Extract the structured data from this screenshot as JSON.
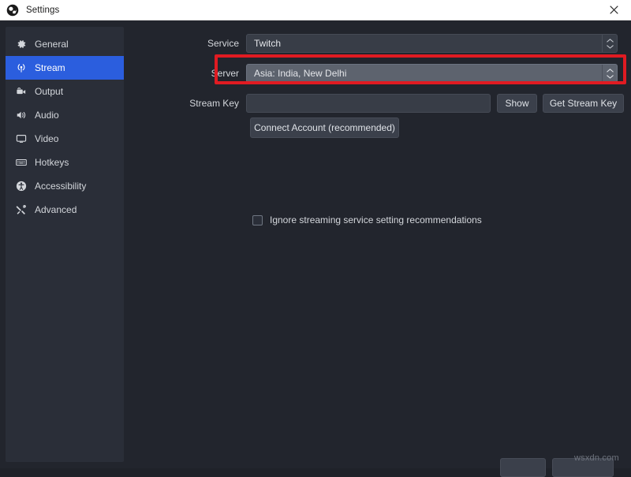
{
  "window": {
    "title": "Settings",
    "app_icon": "obs-logo-icon",
    "close_icon": "close-icon"
  },
  "sidebar": {
    "items": [
      {
        "label": "General",
        "icon": "gear-icon",
        "active": false
      },
      {
        "label": "Stream",
        "icon": "broadcast-icon",
        "active": true
      },
      {
        "label": "Output",
        "icon": "video-camera-icon",
        "active": false
      },
      {
        "label": "Audio",
        "icon": "speaker-icon",
        "active": false
      },
      {
        "label": "Video",
        "icon": "monitor-icon",
        "active": false
      },
      {
        "label": "Hotkeys",
        "icon": "keyboard-icon",
        "active": false
      },
      {
        "label": "Accessibility",
        "icon": "accessibility-icon",
        "active": false
      },
      {
        "label": "Advanced",
        "icon": "tools-icon",
        "active": false
      }
    ]
  },
  "stream_settings": {
    "service": {
      "label": "Service",
      "value": "Twitch"
    },
    "server": {
      "label": "Server",
      "value": "Asia: India, New Delhi",
      "highlighted": true
    },
    "stream_key": {
      "label": "Stream Key",
      "value": "",
      "placeholder": "",
      "show_button": "Show",
      "get_key_button": "Get Stream Key"
    },
    "connect_account_button": "Connect Account (recommended)",
    "ignore_recommendations": {
      "label": "Ignore streaming service setting recommendations",
      "checked": false
    }
  },
  "watermark": "wsxdn.com",
  "colors": {
    "accent": "#2b5ede",
    "highlight": "#e01b22",
    "window_bg": "#22252d",
    "sidebar_bg": "#2a2e38",
    "control_bg": "#383d47",
    "control_hover_bg": "#5d636e",
    "titlebar_bg": "#ffffff"
  }
}
